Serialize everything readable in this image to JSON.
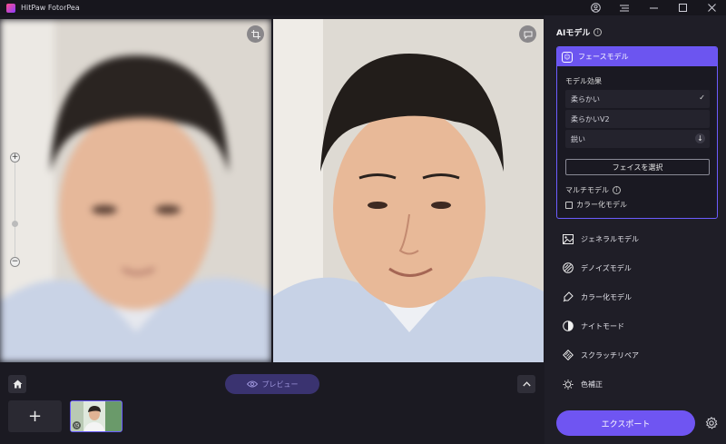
{
  "app": {
    "title": "HitPaw FotorPea"
  },
  "titlebar_icons": [
    "account-icon",
    "menu-icon",
    "minimize-icon",
    "maximize-icon",
    "close-icon"
  ],
  "preview": {
    "label": "プレビュー"
  },
  "right_panel": {
    "title": "AIモデル",
    "face_model": {
      "header": "フェースモデル",
      "effect_label": "モデル効果",
      "options": [
        {
          "label": "柔らかい",
          "selected": true
        },
        {
          "label": "柔らかいV2",
          "selected": false
        },
        {
          "label": "鋭い",
          "selected": false
        }
      ],
      "select_face_button": "フェイスを選択",
      "multi_model_label": "マルチモデル",
      "colorize_checkbox": "カラー化モデル"
    },
    "models": [
      {
        "label": "ジェネラルモデル",
        "icon": "image-icon"
      },
      {
        "label": "デノイズモデル",
        "icon": "denoise-icon"
      },
      {
        "label": "カラー化モデル",
        "icon": "colorize-icon"
      },
      {
        "label": "ナイトモード",
        "icon": "night-icon"
      },
      {
        "label": "スクラッチリペア",
        "icon": "scratch-icon"
      },
      {
        "label": "色補正",
        "icon": "color-correct-icon"
      }
    ],
    "export_label": "エクスポート"
  },
  "colors": {
    "accent": "#6f55f2",
    "panel": "#1f1e27",
    "background": "#1b1a22"
  }
}
